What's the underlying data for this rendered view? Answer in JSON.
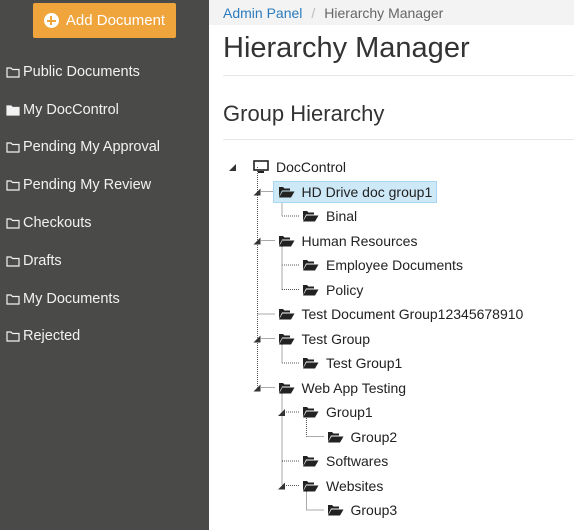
{
  "sidebar": {
    "add_button": "Add Document",
    "items": [
      {
        "label": "Public Documents",
        "icon": "folder-outline-icon"
      },
      {
        "label": "My DocControl",
        "icon": "folder-solid-icon"
      },
      {
        "label": "Pending My Approval",
        "icon": "folder-outline-icon"
      },
      {
        "label": "Pending My Review",
        "icon": "folder-outline-icon"
      },
      {
        "label": "Checkouts",
        "icon": "folder-outline-icon"
      },
      {
        "label": "Drafts",
        "icon": "folder-outline-icon"
      },
      {
        "label": "My Documents",
        "icon": "folder-outline-icon"
      },
      {
        "label": "Rejected",
        "icon": "folder-outline-icon"
      }
    ]
  },
  "breadcrumb": {
    "link": "Admin Panel",
    "separator": "/",
    "current": "Hierarchy Manager"
  },
  "page": {
    "title": "Hierarchy Manager",
    "section_title": "Group Hierarchy"
  },
  "tree": {
    "selected": "HD Drive doc group1",
    "nodes": [
      {
        "label": "DocControl",
        "icon": "computer-icon",
        "depth": 0
      },
      {
        "label": "HD Drive doc group1",
        "icon": "folder-open-icon",
        "depth": 1
      },
      {
        "label": "Binal",
        "icon": "folder-open-icon",
        "depth": 2
      },
      {
        "label": "Human Resources",
        "icon": "folder-open-icon",
        "depth": 1
      },
      {
        "label": "Employee Documents",
        "icon": "folder-open-icon",
        "depth": 2
      },
      {
        "label": "Policy",
        "icon": "folder-open-icon",
        "depth": 2
      },
      {
        "label": "Test Document Group12345678910",
        "icon": "folder-open-icon",
        "depth": 1
      },
      {
        "label": "Test Group",
        "icon": "folder-open-icon",
        "depth": 1
      },
      {
        "label": "Test Group1",
        "icon": "folder-open-icon",
        "depth": 2
      },
      {
        "label": "Web App Testing",
        "icon": "folder-open-icon",
        "depth": 1
      },
      {
        "label": "Group1",
        "icon": "folder-open-icon",
        "depth": 2
      },
      {
        "label": "Group2",
        "icon": "folder-open-icon",
        "depth": 3
      },
      {
        "label": "Softwares",
        "icon": "folder-open-icon",
        "depth": 2
      },
      {
        "label": "Websites",
        "icon": "folder-open-icon",
        "depth": 2
      },
      {
        "label": "Group3",
        "icon": "folder-open-icon",
        "depth": 3
      }
    ]
  },
  "colors": {
    "sidebar_bg": "#4a4a48",
    "add_button_bg": "#f0a43c",
    "link": "#2c7bbd",
    "selected_bg": "#cde8f6"
  }
}
